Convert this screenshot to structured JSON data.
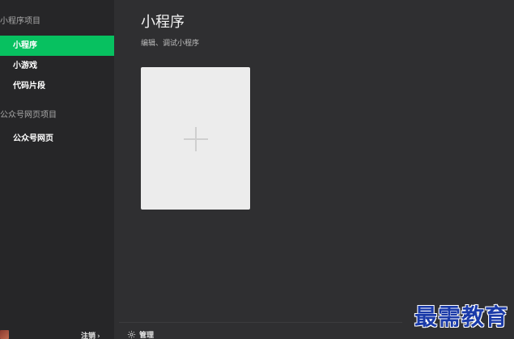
{
  "sidebar": {
    "section_miniprogram": "小程序项目",
    "items": [
      {
        "label": "小程序"
      },
      {
        "label": "小游戏"
      },
      {
        "label": "代码片段"
      }
    ],
    "section_web": "公众号网页项目",
    "web_items": [
      {
        "label": "公众号网页"
      }
    ],
    "logout_label": "注销",
    "logout_chevron": "›"
  },
  "main": {
    "title": "小程序",
    "subtitle": "编辑、调试小程序",
    "manage_label": "管理"
  },
  "watermark": "最需教育",
  "colors": {
    "accent": "#07c160",
    "sidebar_bg": "#262628",
    "main_bg": "#2f2f31",
    "card_bg": "#ececec"
  },
  "icons": {
    "add": "plus-icon",
    "manage": "gear-icon",
    "logout": "chevron-right-icon"
  }
}
